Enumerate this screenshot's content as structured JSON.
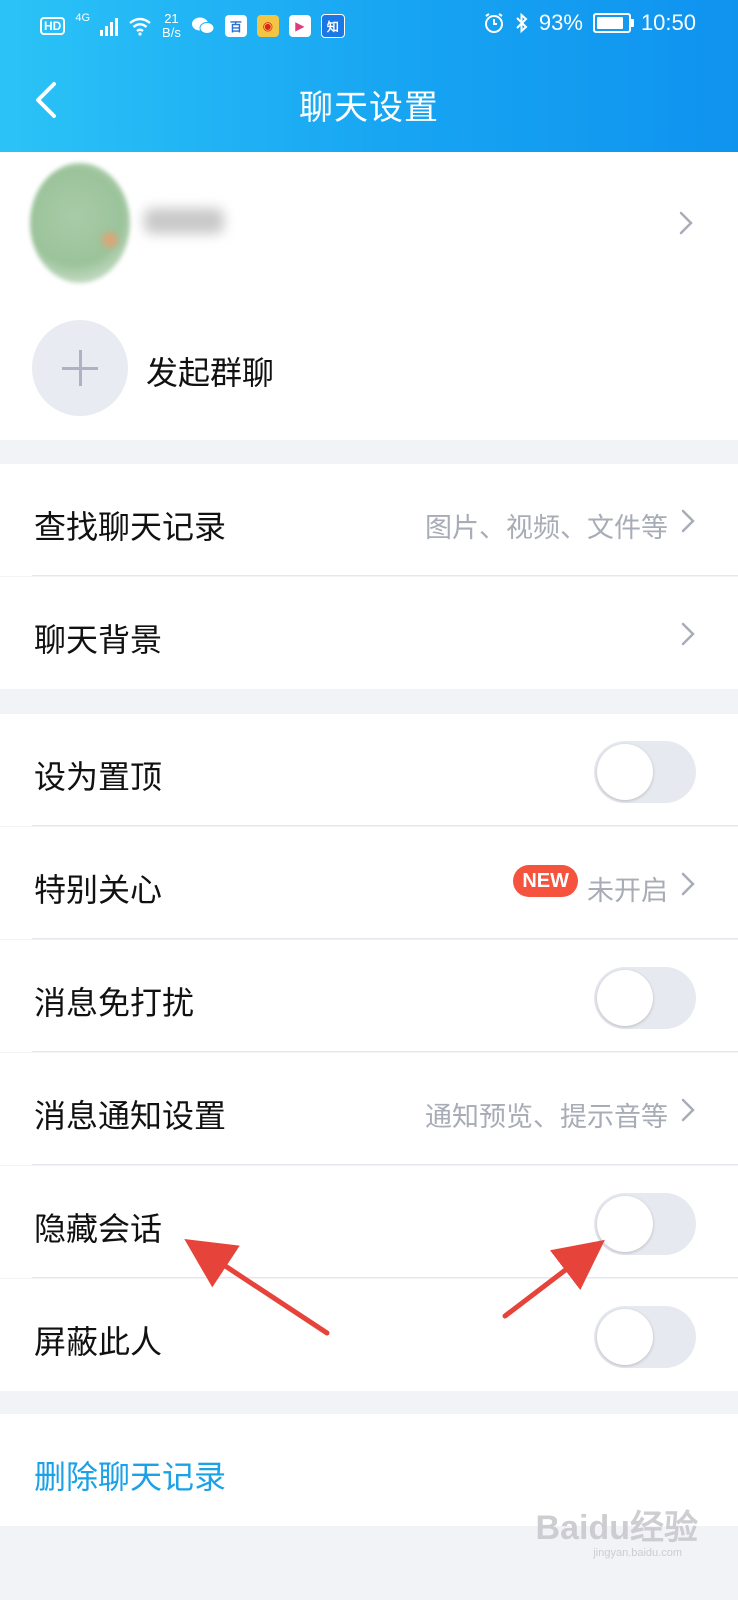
{
  "status_bar": {
    "hd": "HD",
    "net_type": "4G",
    "net_speed_value": "21",
    "net_speed_unit": "B/s",
    "app_icon_3": "知",
    "battery": "93%",
    "time": "10:50"
  },
  "header": {
    "title": "聊天设置"
  },
  "profile": {
    "add_group_label": "发起群聊"
  },
  "rows": {
    "search_history": {
      "label": "查找聊天记录",
      "value": "图片、视频、文件等"
    },
    "chat_background": {
      "label": "聊天背景"
    },
    "pin_top": {
      "label": "设为置顶",
      "toggle_on": false
    },
    "special_care": {
      "label": "特别关心",
      "badge": "NEW",
      "value": "未开启"
    },
    "do_not_disturb": {
      "label": "消息免打扰",
      "toggle_on": false
    },
    "notification_settings": {
      "label": "消息通知设置",
      "value": "通知预览、提示音等"
    },
    "hide_conversation": {
      "label": "隐藏会话",
      "toggle_on": false
    },
    "block_user": {
      "label": "屏蔽此人",
      "toggle_on": false
    }
  },
  "delete": {
    "label": "删除聊天记录"
  },
  "watermark": {
    "text": "Baidu经验",
    "sub": "jingyan.baidu.com"
  },
  "colors": {
    "header_start": "#2bc3f7",
    "header_end": "#0f93ef",
    "accent_link": "#1aa1e6",
    "badge": "#f5533d",
    "annotation_arrow": "#e6443a"
  }
}
